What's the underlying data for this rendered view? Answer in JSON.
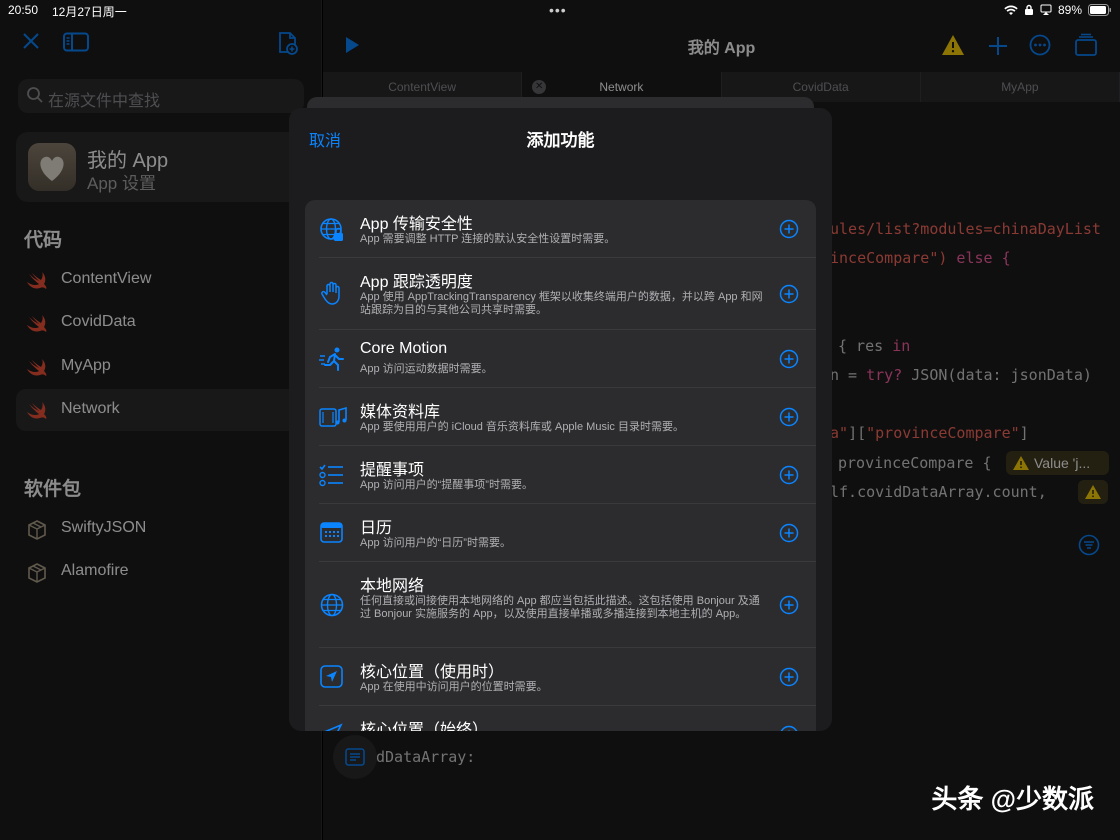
{
  "status": {
    "time": "20:50",
    "date": "12月27日周一",
    "battery": "89%"
  },
  "sidebar": {
    "search_placeholder": "在源文件中查找",
    "app": {
      "name": "我的 App",
      "subtitle": "App 设置"
    },
    "code_header": "代码",
    "code_items": [
      {
        "label": "ContentView"
      },
      {
        "label": "CovidData"
      },
      {
        "label": "MyApp"
      },
      {
        "label": "Network"
      }
    ],
    "packages_header": "软件包",
    "package_items": [
      {
        "label": "SwiftyJSON"
      },
      {
        "label": "Alamofire"
      }
    ]
  },
  "editor": {
    "title": "我的 App",
    "tabs": [
      {
        "label": "ContentView"
      },
      {
        "label": "Network"
      },
      {
        "label": "CovidData"
      },
      {
        "label": "MyApp"
      }
    ],
    "code_lines": [
      {
        "text": "ules/list?modules=chinaDayList"
      },
      {
        "text_a": "ince",
        "text_b": "Compare\")",
        "text_c": " else {"
      },
      {
        "text_a": "{ res ",
        "text_b": "in"
      },
      {
        "text_a": "n = ",
        "text_b": "try?",
        "text_c": " JSON(data: jsonData)"
      },
      {
        "text_a": "a\"",
        "text_b": "][",
        "text_c": "\"provinceCompare\"",
        "text_d": "]"
      },
      {
        "text": "provinceCompare {"
      },
      {
        "text": "lf.covidDataArray.count,"
      },
      {
        "text": "dDataArray:"
      }
    ],
    "warning_pill": "Value 'j..."
  },
  "modal": {
    "cancel": "取消",
    "title": "添加功能",
    "items": [
      {
        "title": "App 传输安全性",
        "desc": "App 需要调整 HTTP 连接的默认安全性设置时需要。",
        "icon": "globe-lock-icon"
      },
      {
        "title": "App 跟踪透明度",
        "desc": "App 使用 AppTrackingTransparency 框架以收集终端用户的数据，并以跨 App 和网站跟踪为目的与其他公司共享时需要。",
        "icon": "hand-icon"
      },
      {
        "title": "Core Motion",
        "desc": "App 访问运动数据时需要。",
        "icon": "running-figure-icon"
      },
      {
        "title": "媒体资料库",
        "desc": "App 要使用用户的 iCloud 音乐资料库或 Apple Music 目录时需要。",
        "icon": "music-library-icon"
      },
      {
        "title": "提醒事项",
        "desc": "App 访问用户的“提醒事项”时需要。",
        "icon": "checklist-icon"
      },
      {
        "title": "日历",
        "desc": "App 访问用户的“日历”时需要。",
        "icon": "calendar-icon"
      },
      {
        "title": "本地网络",
        "desc": "任何直接或间接使用本地网络的 App 都应当包括此描述。这包括使用 Bonjour 及通过 Bonjour 实施服务的 App，以及使用直接单播或多播连接到本地主机的 App。",
        "icon": "globe-icon"
      },
      {
        "title": "核心位置（使用时）",
        "desc": "App 在使用中访问用户的位置时需要。",
        "icon": "location-arrow-icon"
      },
      {
        "title": "核心位置（始终）",
        "desc": "",
        "icon": "location-arrow-icon"
      }
    ]
  },
  "watermark": "头条 @少数派",
  "colors": {
    "accent": "#0a84ff",
    "warning": "#ffd60a",
    "swift": "#f05138"
  }
}
